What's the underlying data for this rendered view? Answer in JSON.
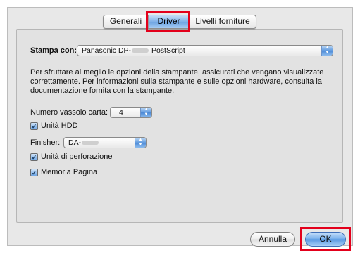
{
  "tabs": [
    {
      "label": "Generali",
      "active": false
    },
    {
      "label": "Driver",
      "active": true
    },
    {
      "label": "Livelli forniture",
      "active": false
    }
  ],
  "printer": {
    "label": "Stampa con:",
    "value_prefix": "Panasonic DP-",
    "value_suffix": " PostScript"
  },
  "description": "Per sfruttare al meglio le opzioni della stampante, assicurati che vengano visualizzate correttamente. Per informazioni sulla stampante e sulle opzioni hardware, consulta la documentazione fornita con la stampante.",
  "tray": {
    "label": "Numero vassoio carta:",
    "value": "4"
  },
  "hdd": {
    "label": "Unità HDD",
    "checked": true
  },
  "finisher": {
    "label": "Finisher:",
    "value_prefix": "DA-"
  },
  "punch": {
    "label": "Unità di perforazione",
    "checked": true
  },
  "page_memory": {
    "label": "Memoria Pagina",
    "checked": true
  },
  "buttons": {
    "cancel": "Annulla",
    "ok": "OK"
  },
  "colors": {
    "highlight": "#e3001b",
    "accent": "#5e99de"
  }
}
